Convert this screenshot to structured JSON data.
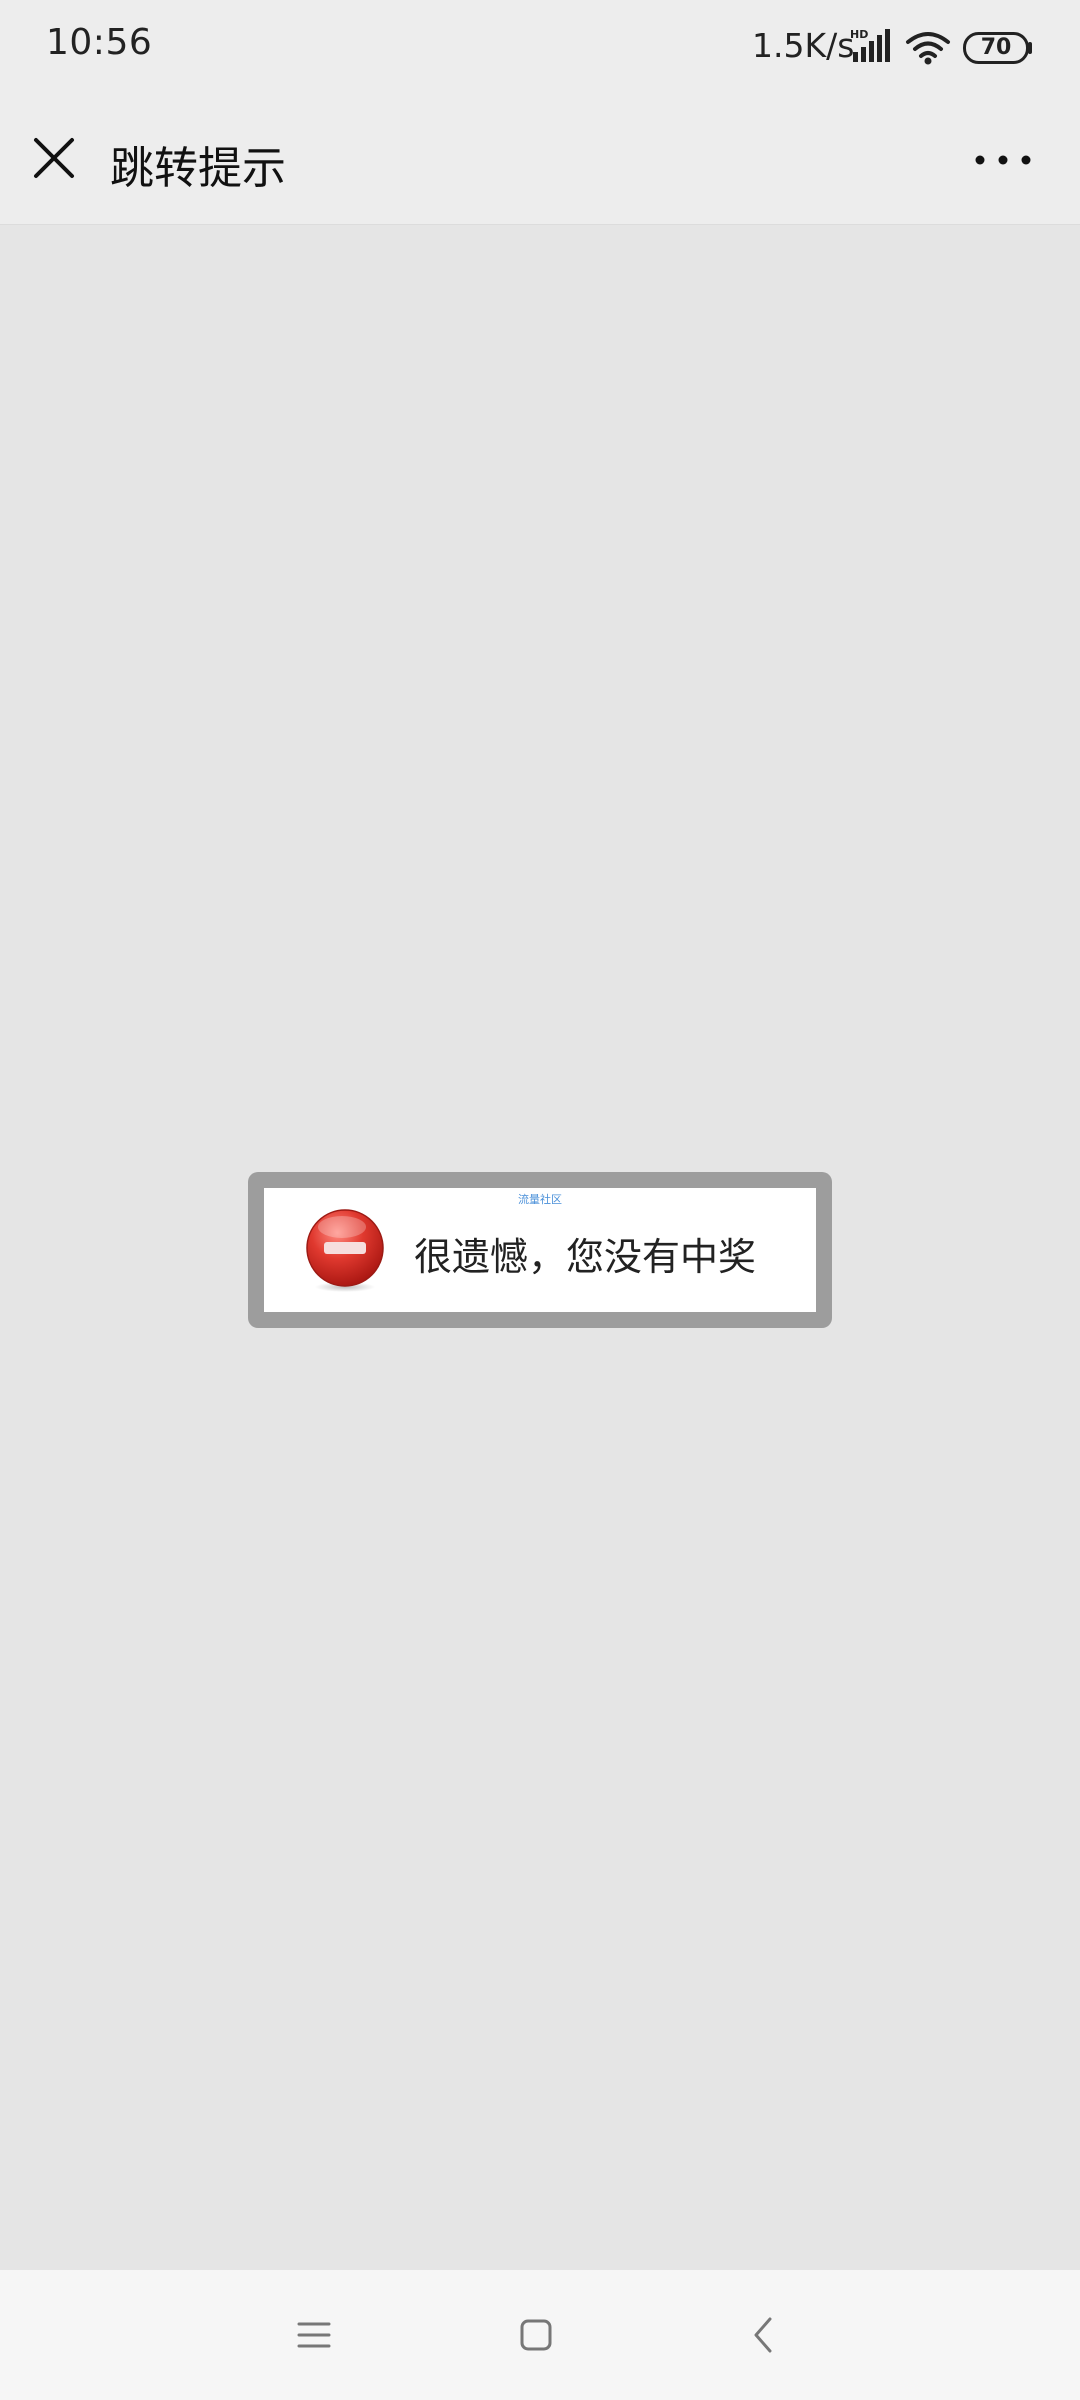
{
  "status_bar": {
    "time": "10:56",
    "network_speed": "1.5K/s",
    "signal_label": "HD",
    "battery_level": "70"
  },
  "title_bar": {
    "title": "跳转提示"
  },
  "dialog": {
    "watermark": "流量社区",
    "message": "很遗憾，您没有中奖"
  },
  "colors": {
    "page_background": "#e5e5e5",
    "bar_background": "#ededed",
    "dialog_frame": "#9d9d9d",
    "error_red": "#d9342b",
    "watermark_blue": "#4a90d9"
  },
  "icons": {
    "close": "close-icon",
    "more": "more-icon",
    "error": "error-icon",
    "menu": "menu-icon",
    "home": "home-icon",
    "back": "back-icon"
  }
}
